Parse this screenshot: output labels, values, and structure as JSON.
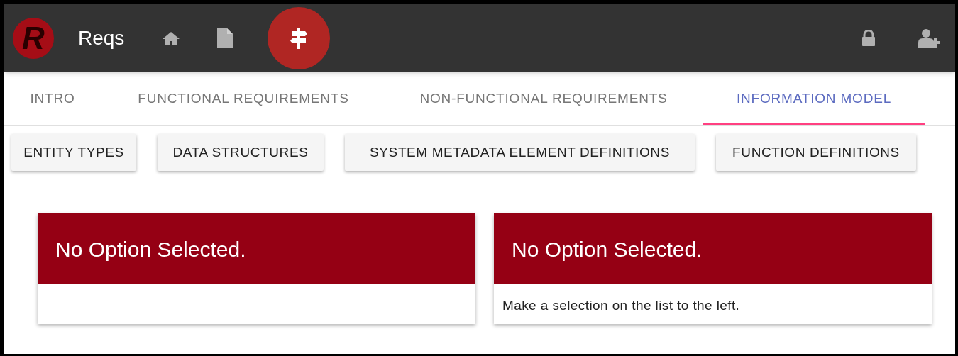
{
  "header": {
    "logo_letter": "R",
    "title": "Reqs",
    "nav_icons": [
      {
        "kind": "home",
        "selected": false
      },
      {
        "kind": "file",
        "selected": false
      },
      {
        "kind": "signpost",
        "selected": true
      }
    ],
    "right_icons": [
      {
        "kind": "lock"
      },
      {
        "kind": "add-user"
      }
    ]
  },
  "tabs": [
    {
      "label": "INTRO",
      "selected": false
    },
    {
      "label": "FUNCTIONAL REQUIREMENTS",
      "selected": false
    },
    {
      "label": "NON-FUNCTIONAL REQUIREMENTS",
      "selected": false
    },
    {
      "label": "INFORMATION MODEL",
      "selected": true
    }
  ],
  "buttons": [
    "ENTITY TYPES",
    "DATA STRUCTURES",
    "SYSTEM METADATA ELEMENT DEFINITIONS",
    "FUNCTION DEFINITIONS"
  ],
  "cards": [
    {
      "title": "No Option Selected."
    },
    {
      "title": "No Option Selected.",
      "body": "Make a selection on the list to the left."
    }
  ]
}
